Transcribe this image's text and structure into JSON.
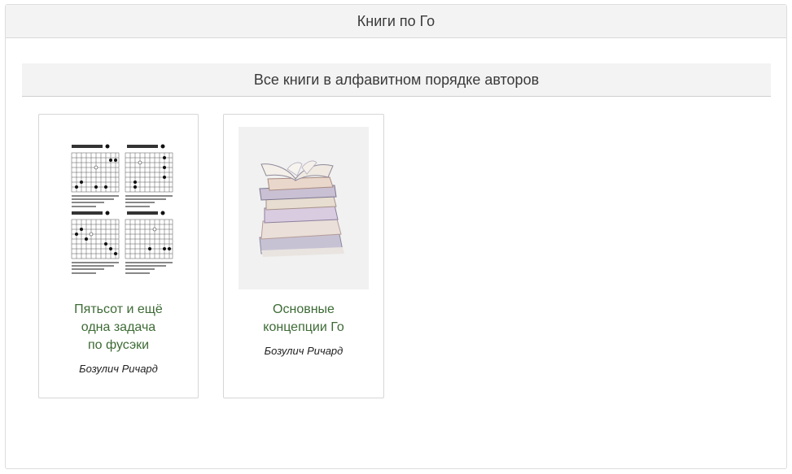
{
  "page": {
    "title": "Книги по Го",
    "section_title": "Все книги в алфавитном порядке авторов"
  },
  "books": [
    {
      "title_lines": [
        "Пятьсот и ещё",
        "одна задача",
        "по фусэки"
      ],
      "author": "Бозулич Ричард",
      "cover": "go-problems-cover"
    },
    {
      "title_lines": [
        "Основные",
        "концепции Го"
      ],
      "author": "Бозулич Ричард",
      "cover": "stack-of-books-cover"
    }
  ]
}
